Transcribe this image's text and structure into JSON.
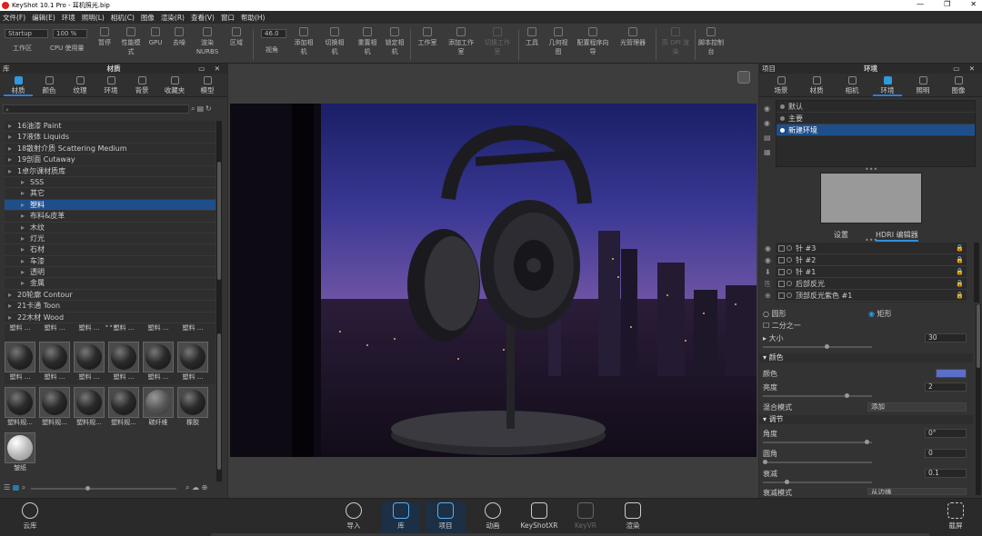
{
  "title": "KeyShot 10.1 Pro  -  耳机照光.bip",
  "menu": [
    "文件(F)",
    "编辑(E)",
    "环境",
    "照明(L)",
    "相机(C)",
    "图像",
    "渲染(R)",
    "查看(V)",
    "窗口",
    "帮助(H)"
  ],
  "toolbar": {
    "startup": "Startup",
    "zoom": "100 %",
    "fov": "46.0",
    "items": [
      "工作区",
      "CPU 使用量",
      "暂停",
      "性能模式",
      "GPU",
      "去噪",
      "渲染 NURBS",
      "区域",
      "视角",
      "添加相机",
      "切换相机",
      "重置相机",
      "锁定相机",
      "工作室",
      "添加工作室",
      "切换工作室",
      "工具",
      "几何视图",
      "配置程序向导",
      "光管理器",
      "高 DPI 渲染",
      "脚本控制台"
    ]
  },
  "library": {
    "header": "库",
    "title": "材质",
    "tabs": [
      "材质",
      "颜色",
      "纹理",
      "环境",
      "背景",
      "收藏夹",
      "模型"
    ],
    "tree": [
      {
        "label": "16油漆 Paint",
        "indent": 1
      },
      {
        "label": "17液体 Liquids",
        "indent": 1
      },
      {
        "label": "18散射介质 Scattering Medium",
        "indent": 1
      },
      {
        "label": "19剖面 Cutaway",
        "indent": 1
      },
      {
        "label": "1卓尔课材质库",
        "indent": 1
      },
      {
        "label": "SSS",
        "indent": 2
      },
      {
        "label": "其它",
        "indent": 2
      },
      {
        "label": "塑料",
        "indent": 2,
        "selected": true
      },
      {
        "label": "布料&皮革",
        "indent": 2
      },
      {
        "label": "木纹",
        "indent": 2
      },
      {
        "label": "灯光",
        "indent": 2
      },
      {
        "label": "石材",
        "indent": 2
      },
      {
        "label": "车漆",
        "indent": 2
      },
      {
        "label": "透明",
        "indent": 2
      },
      {
        "label": "金属",
        "indent": 2
      },
      {
        "label": "20轮廓 Contour",
        "indent": 1
      },
      {
        "label": "21卡通 Toon",
        "indent": 1
      },
      {
        "label": "22木材 Wood",
        "indent": 1
      }
    ],
    "thumbs_row0": [
      "塑料 ...",
      "塑料 ...",
      "塑料 ...",
      "塑料 ...",
      "塑料 ...",
      "塑料 ..."
    ],
    "thumbs_row1": [
      "塑料 ...",
      "塑料 ...",
      "塑料 ...",
      "塑料 ...",
      "塑料 ...",
      "塑料 ..."
    ],
    "thumbs_row2": [
      "塑料规...",
      "塑料规...",
      "塑料规...",
      "塑料规...",
      "碳纤维",
      "橡胶"
    ],
    "thumbs_row3": [
      "皱纸"
    ]
  },
  "project": {
    "header": "项目",
    "title": "环境",
    "tabs": [
      "场景",
      "材质",
      "相机",
      "环境",
      "照明",
      "图像"
    ],
    "environments": [
      {
        "label": "默认"
      },
      {
        "label": "主要"
      },
      {
        "label": "新建环境",
        "selected": true
      }
    ],
    "subtabs": [
      "设置",
      "HDRI 编辑器"
    ],
    "lights": [
      "针 #3",
      "针 #2",
      "针 #1",
      "后部反光",
      "顶部反光紫色 #1"
    ],
    "shape_circle": "圆形",
    "shape_rect": "矩形",
    "half": "二分之一",
    "size_label": "大小",
    "size_value": "30",
    "color_section": "颜色",
    "color_label": "颜色",
    "color_value": "#5a6fc8",
    "brightness_label": "亮度",
    "brightness_value": "2",
    "blend_label": "混合模式",
    "blend_value": "添加",
    "adjust_section": "调节",
    "angle_label": "角度",
    "angle_value": "0°",
    "roundness_label": "圆角",
    "roundness_value": "0",
    "falloff_label": "衰减",
    "falloff_value": "0.1",
    "falloff_mode_label": "衰减模式",
    "falloff_mode_value": "从边缘"
  },
  "bottom": {
    "cloud": "云库",
    "items": [
      "导入",
      "库",
      "项目",
      "动画",
      "KeyShotXR",
      "KeyVR",
      "渲染"
    ],
    "screenshot": "截屏"
  }
}
